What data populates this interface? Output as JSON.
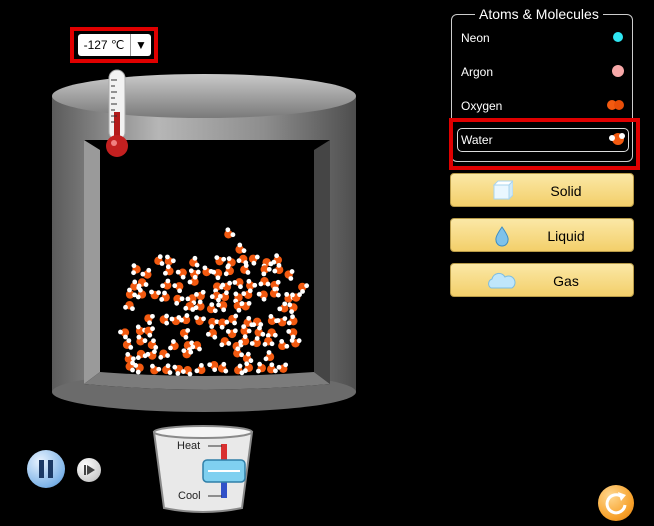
{
  "thermometer": {
    "value": "-127 ℃",
    "dropdown_icon": "triangle-down-icon"
  },
  "panel": {
    "title": "Atoms & Molecules",
    "species": [
      {
        "label": "Neon",
        "color": "#2fe6f2"
      },
      {
        "label": "Argon",
        "color": "#f7a8a8"
      },
      {
        "label": "Oxygen",
        "color": "#f35a10"
      },
      {
        "label": "Water",
        "color": "#f35a10",
        "selected": true
      }
    ]
  },
  "phases": [
    {
      "label": "Solid",
      "icon": "ice-cube-icon"
    },
    {
      "label": "Liquid",
      "icon": "droplet-icon"
    },
    {
      "label": "Gas",
      "icon": "cloud-icon"
    }
  ],
  "heater": {
    "heat_label": "Heat",
    "cool_label": "Cool"
  },
  "controls": {
    "pause_icon": "pause-icon",
    "step_icon": "step-forward-icon",
    "reset_icon": "reset-icon"
  },
  "colors": {
    "highlight": "#e00000",
    "oxygen_atom": "#f35a10",
    "hydrogen_atom": "#ffffff",
    "button_fill": "#f6d77e"
  }
}
